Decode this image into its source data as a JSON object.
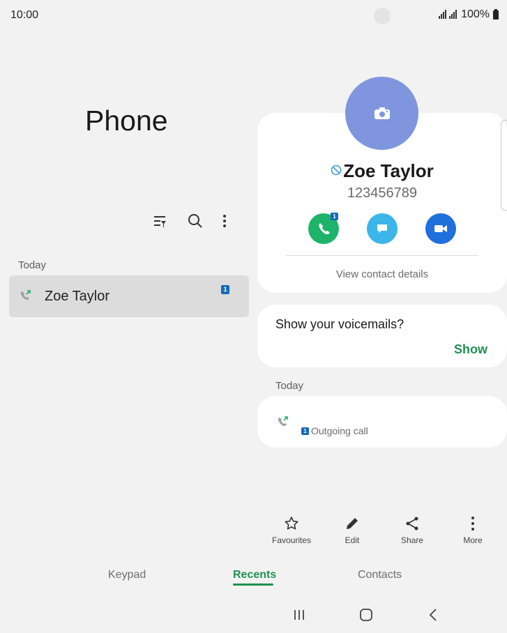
{
  "status": {
    "time": "10:00",
    "battery": "100%"
  },
  "app": {
    "title": "Phone"
  },
  "colors": {
    "accent": "#1d9151",
    "call": "#1db469",
    "message": "#3bb6e8",
    "video": "#1f6fdc",
    "avatar": "#7f96df",
    "sim": "#1769b8"
  },
  "recents": {
    "section": "Today",
    "items": [
      {
        "name": "Zoe Taylor",
        "sim": "1",
        "icon": "outgoing-call-icon"
      }
    ]
  },
  "contact": {
    "name": "Zoe Taylor",
    "number": "123456789",
    "call_sim": "1",
    "view_details": "View contact details"
  },
  "voicemail": {
    "prompt": "Show your voicemails?",
    "action": "Show"
  },
  "history": {
    "section": "Today",
    "entries": [
      {
        "sim": "1",
        "label": "Outgoing call"
      }
    ]
  },
  "actions": [
    {
      "label": "Favourites",
      "icon": "star-icon"
    },
    {
      "label": "Edit",
      "icon": "pencil-icon"
    },
    {
      "label": "Share",
      "icon": "share-icon"
    },
    {
      "label": "More",
      "icon": "more-vertical-icon"
    }
  ],
  "tabs": [
    {
      "label": "Keypad",
      "active": false
    },
    {
      "label": "Recents",
      "active": true
    },
    {
      "label": "Contacts",
      "active": false
    }
  ]
}
